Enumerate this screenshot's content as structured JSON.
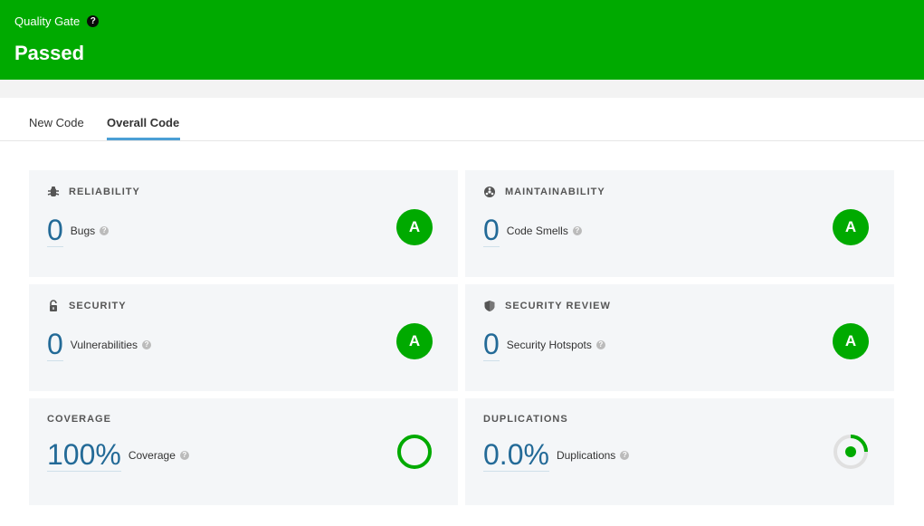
{
  "header": {
    "gate_label": "Quality Gate",
    "help": "?",
    "status": "Passed"
  },
  "tabs": [
    {
      "label": "New Code",
      "active": false
    },
    {
      "label": "Overall Code",
      "active": true
    }
  ],
  "cards": {
    "reliability": {
      "title": "RELIABILITY",
      "icon": "bug-icon",
      "value": "0",
      "label": "Bugs",
      "rating": "A"
    },
    "maintainability": {
      "title": "MAINTAINABILITY",
      "icon": "radiation-icon",
      "value": "0",
      "label": "Code Smells",
      "rating": "A"
    },
    "security": {
      "title": "SECURITY",
      "icon": "unlock-icon",
      "value": "0",
      "label": "Vulnerabilities",
      "rating": "A"
    },
    "security_review": {
      "title": "SECURITY REVIEW",
      "icon": "shield-icon",
      "value": "0",
      "label": "Security Hotspots",
      "rating": "A"
    },
    "coverage": {
      "title": "COVERAGE",
      "value": "100%",
      "label": "Coverage"
    },
    "duplications": {
      "title": "DUPLICATIONS",
      "value": "0.0%",
      "label": "Duplications"
    }
  },
  "colors": {
    "brand_green": "#00aa00",
    "metric_blue": "#236a97",
    "tab_accent": "#4b9fd5"
  }
}
